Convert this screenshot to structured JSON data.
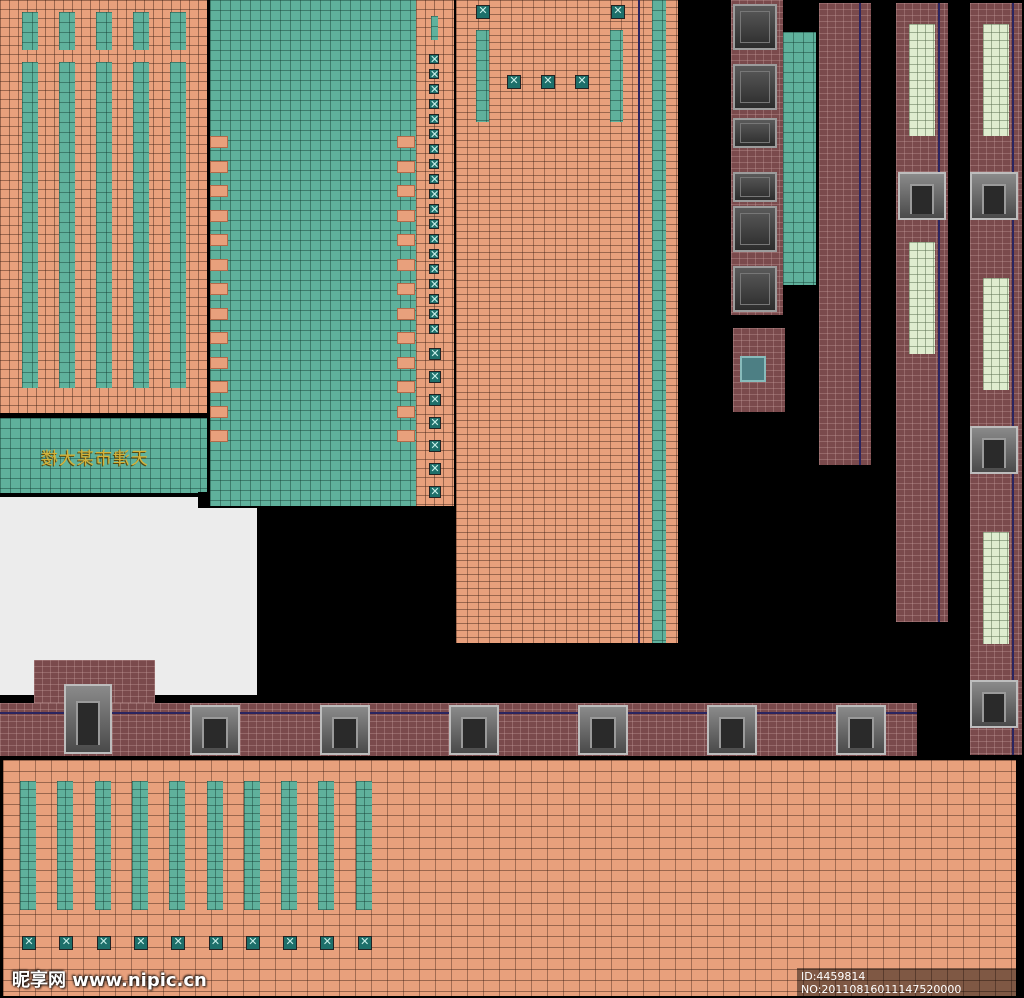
{
  "sign": {
    "text": "天津市某大楼"
  },
  "watermark": {
    "left": "昵享网 www.nipic.cn",
    "right": "ID:4459814 NO:20110816011147520000"
  },
  "colors": {
    "salmon": "#e8a07c",
    "teal": "#5fb19c",
    "brick": "#7a4a4c",
    "navy": "#2a2560",
    "light_window": "#dfeccf",
    "white_panel": "#ececec",
    "background": "#000000"
  }
}
